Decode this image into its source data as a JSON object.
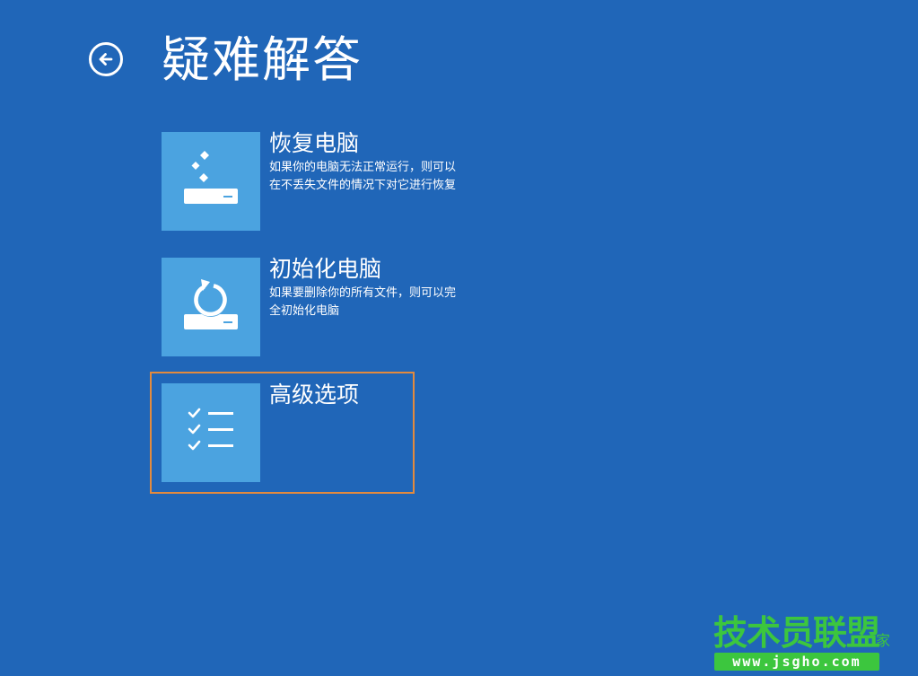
{
  "colors": {
    "background": "#2066b8",
    "tile": "#4ba3e0",
    "highlight": "#e28a3e",
    "watermark": "#3cc63e"
  },
  "header": {
    "back_icon": "arrow-left-circle-icon",
    "title": "疑难解答"
  },
  "options": [
    {
      "icon": "refresh-pc-icon",
      "title": "恢复电脑",
      "desc_lines": [
        "如果你的电脑无法正常运行，则可以",
        "在不丢失文件的情况下对它进行恢复"
      ]
    },
    {
      "icon": "reset-pc-icon",
      "title": "初始化电脑",
      "desc_lines": [
        "如果要删除你的所有文件，则可以完",
        "全初始化电脑"
      ]
    },
    {
      "icon": "checklist-icon",
      "title": "高级选项",
      "desc_lines": []
    }
  ],
  "watermark": {
    "title": "技术员联盟",
    "suffix": "家",
    "url": "www.jsgho.com"
  }
}
